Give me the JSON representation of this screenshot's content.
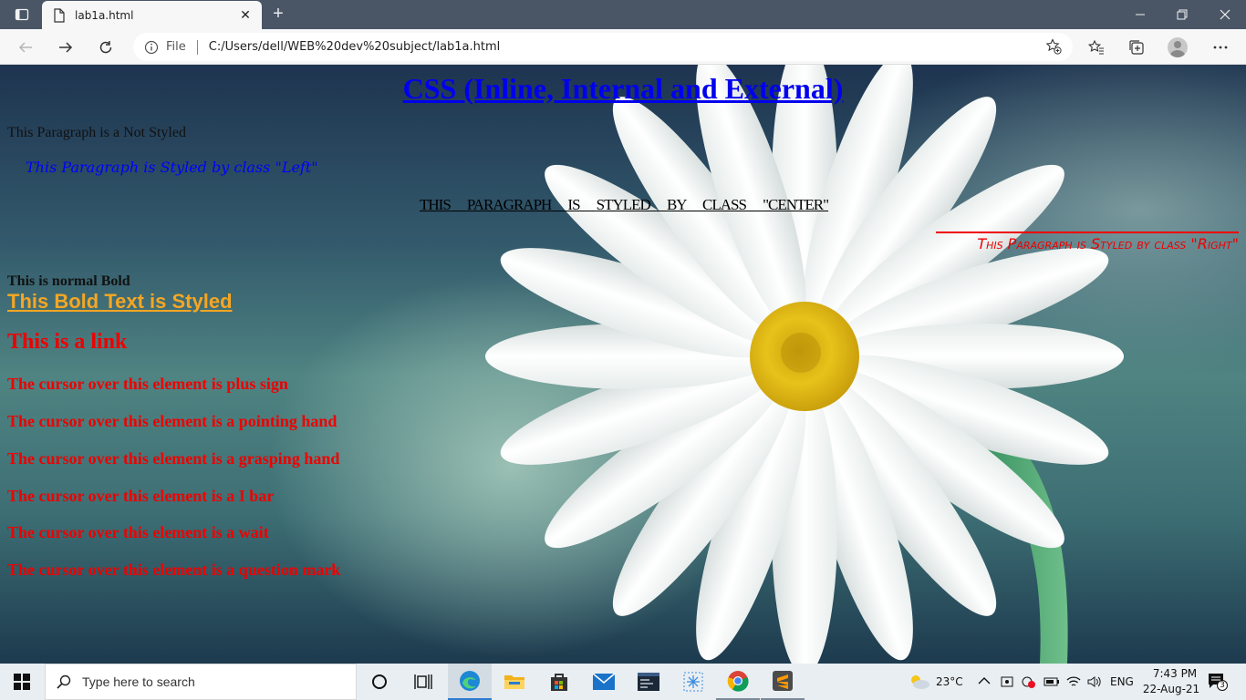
{
  "browser": {
    "tab_title": "lab1a.html",
    "address_prefix": "File",
    "url": "C:/Users/dell/WEB%20dev%20subject/lab1a.html"
  },
  "page": {
    "heading": "CSS (Inline, Internal and External)",
    "p_not_styled": "This Paragraph is a Not Styled",
    "p_left": "This Paragraph is Styled by class \"Left\"",
    "p_center_words": [
      "This",
      "Paragraph",
      "is",
      "styled",
      "by",
      "class",
      "\"center\""
    ],
    "p_right": "This Paragraph is Styled by class \"Right\"",
    "bold_normal": "This is normal Bold",
    "bold_styled": "This Bold Text is Styled",
    "link": "This is a link",
    "cursor_lines": [
      "The cursor over this element is plus sign",
      "The cursor over this element is a pointing hand",
      "The cursor over this element is a grasping hand",
      "The cursor over this element is a I bar",
      "The cursor over this element is a wait",
      "The cursor over this element is a question mark"
    ]
  },
  "taskbar": {
    "search_placeholder": "Type here to search",
    "weather": "23°C",
    "language": "ENG",
    "time": "7:43 PM",
    "date": "22-Aug-21",
    "notifications": "3"
  },
  "colors": {
    "heading": "#0000ee",
    "left": "#0000ff",
    "right": "#ee0000",
    "styled_bold": "#f5a623",
    "cursor_text": "#ee0000"
  }
}
